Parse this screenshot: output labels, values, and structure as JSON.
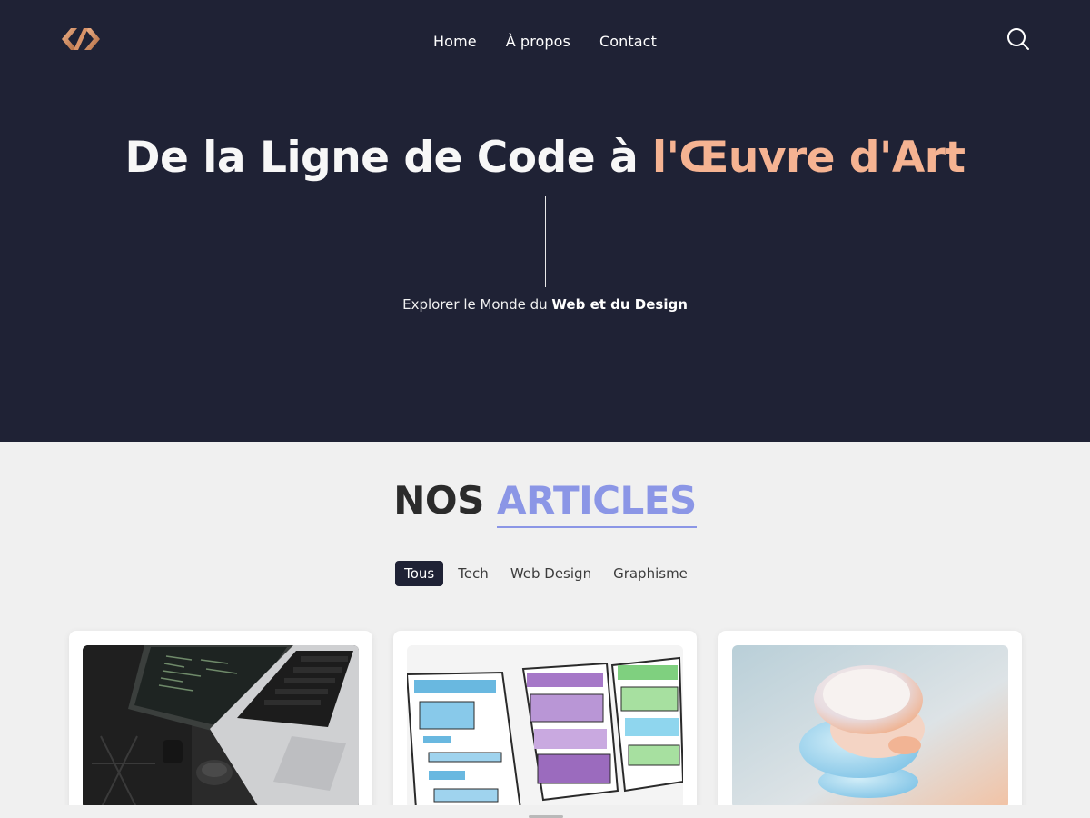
{
  "nav": {
    "logo": "code-logo",
    "links": [
      "Home",
      "À propos",
      "Contact"
    ],
    "search_icon": "search-icon"
  },
  "hero": {
    "title_main": "De la Ligne de Code à ",
    "title_accent": "l'Œuvre d'Art",
    "subtitle_main": "Explorer le Monde du ",
    "subtitle_bold": "Web et du Design"
  },
  "articles": {
    "title_main": "NOS ",
    "title_accent": "ARTICLES",
    "filters": [
      "Tous",
      "Tech",
      "Web Design",
      "Graphisme"
    ],
    "active_filter": "Tous",
    "cards": [
      {
        "image": "laptop-photo"
      },
      {
        "image": "wireframe-sketch-photo"
      },
      {
        "image": "abstract-3d-render"
      }
    ]
  },
  "colors": {
    "hero_bg": "#1f2235",
    "accent_peach": "#f5b392",
    "accent_purple": "#8b96e6",
    "page_bg": "#f0f0f0"
  }
}
